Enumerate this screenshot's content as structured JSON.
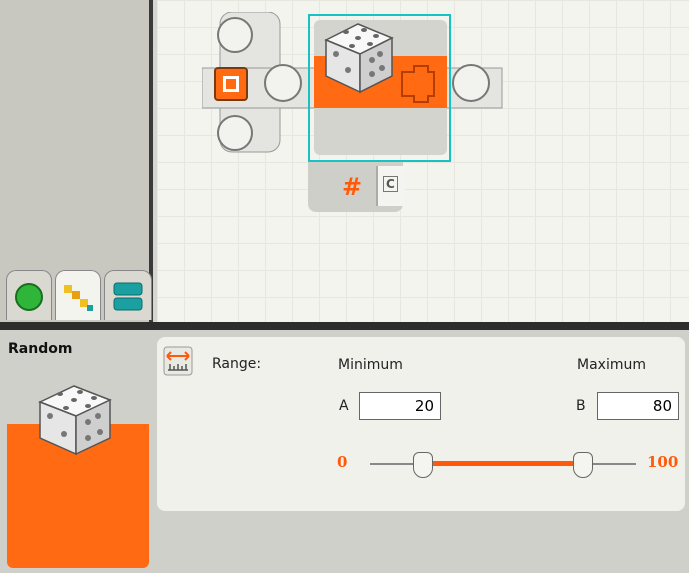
{
  "block": {
    "title": "Random",
    "icon": "dice-icon",
    "hub_symbol": "#",
    "hub_port": "C"
  },
  "palette_tabs": [
    {
      "icon": "common-palette-icon",
      "color": "#2fb53a"
    },
    {
      "icon": "complete-palette-icon",
      "color": "#f0c020"
    },
    {
      "icon": "custom-palette-icon",
      "color": "#1aa0a0"
    }
  ],
  "config": {
    "range_label": "Range:",
    "minimum_label": "Minimum",
    "maximum_label": "Maximum",
    "a_label": "A",
    "b_label": "B",
    "a_value": "20",
    "b_value": "80",
    "slider_min_label": "0",
    "slider_max_label": "100",
    "slider_min": 0,
    "slider_max": 100,
    "thumb_a": 20,
    "thumb_b": 80
  },
  "colors": {
    "accent": "#ff6a13",
    "selection": "#19c2c2"
  }
}
